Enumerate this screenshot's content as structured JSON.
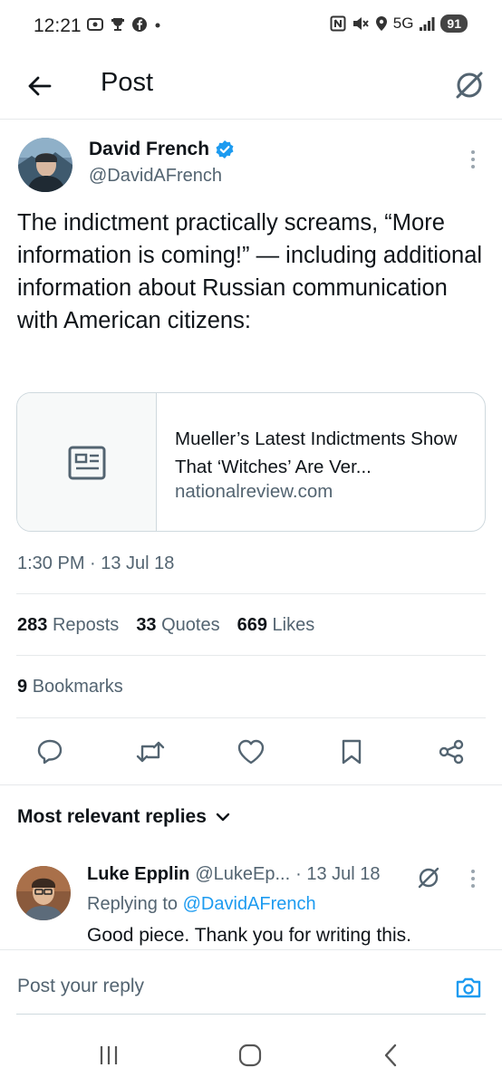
{
  "status_bar": {
    "time": "12:21",
    "network": "5G",
    "battery": "91"
  },
  "header": {
    "title": "Post",
    "back_icon": "arrow-left-icon",
    "grok_icon": "grok-icon"
  },
  "post": {
    "author": {
      "name": "David French",
      "handle": "@DavidAFrench",
      "verified": true
    },
    "text": "The indictment practically screams, “More information is coming!” — including additional information about Russian communication with American citizens:",
    "link_card": {
      "title": "Mueller’s Latest Indictments Show That ‘Witches’ Are Ver...",
      "domain": "nationalreview.com"
    },
    "timestamp": "1:30 PM · 13 Jul 18",
    "stats": {
      "reposts_count": "283",
      "reposts_label": "Reposts",
      "quotes_count": "33",
      "quotes_label": "Quotes",
      "likes_count": "669",
      "likes_label": "Likes",
      "bookmarks_count": "9",
      "bookmarks_label": "Bookmarks"
    }
  },
  "replies": {
    "sort_label": "Most relevant replies",
    "items": [
      {
        "name": "Luke Epplin",
        "handle": "@LukeEp...",
        "date": "· 13 Jul 18",
        "replying_prefix": "Replying to",
        "replying_to": "@DavidAFrench",
        "text": "Good piece. Thank you for writing this."
      }
    ]
  },
  "composer": {
    "placeholder": "Post your reply"
  },
  "colors": {
    "accent": "#1d9bf0",
    "text": "#0f1419",
    "secondary": "#536471",
    "border": "#cfd9de"
  }
}
